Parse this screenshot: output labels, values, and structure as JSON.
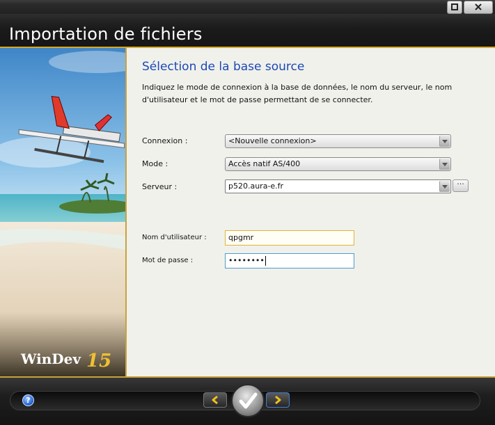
{
  "window": {
    "title": "Importation de fichiers",
    "maximize_icon": "maximize-icon",
    "close_icon": "close-icon"
  },
  "branding": {
    "logo_text": "WinDev",
    "logo_version": "15"
  },
  "page": {
    "heading": "Sélection de la base source",
    "description": "Indiquez le mode de connexion à la base de données, le nom du serveur, le nom d'utilisateur et le mot de passe permettant de se connecter."
  },
  "form": {
    "connexion": {
      "label": "Connexion :",
      "value": "<Nouvelle connexion>"
    },
    "mode": {
      "label": "Mode :",
      "value": "Accès natif AS/400"
    },
    "serveur": {
      "label": "Serveur :",
      "value": "p520.aura-e.fr",
      "browse_label": "···"
    },
    "utilisateur": {
      "label": "Nom d'utilisateur :",
      "value": "qpgmr"
    },
    "motdepasse": {
      "label": "Mot de passe :",
      "value": "••••••••"
    }
  },
  "footer": {
    "help_label": "?",
    "prev_icon": "chevron-left-icon",
    "next_icon": "chevron-right-icon",
    "finish_icon": "checkmark-icon"
  },
  "colors": {
    "accent_gold": "#d8a82a",
    "heading_blue": "#1b48b8",
    "focus_blue": "#4f9bc8"
  }
}
